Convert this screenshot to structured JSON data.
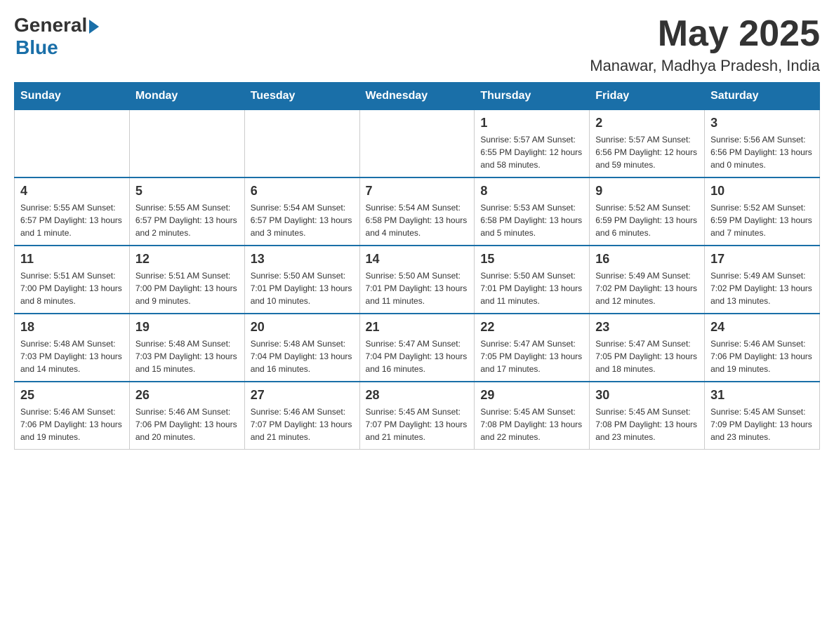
{
  "header": {
    "logo_general": "General",
    "logo_blue": "Blue",
    "month_title": "May 2025",
    "location": "Manawar, Madhya Pradesh, India"
  },
  "days_of_week": [
    "Sunday",
    "Monday",
    "Tuesday",
    "Wednesday",
    "Thursday",
    "Friday",
    "Saturday"
  ],
  "weeks": [
    [
      {
        "day": "",
        "info": ""
      },
      {
        "day": "",
        "info": ""
      },
      {
        "day": "",
        "info": ""
      },
      {
        "day": "",
        "info": ""
      },
      {
        "day": "1",
        "info": "Sunrise: 5:57 AM\nSunset: 6:55 PM\nDaylight: 12 hours\nand 58 minutes."
      },
      {
        "day": "2",
        "info": "Sunrise: 5:57 AM\nSunset: 6:56 PM\nDaylight: 12 hours\nand 59 minutes."
      },
      {
        "day": "3",
        "info": "Sunrise: 5:56 AM\nSunset: 6:56 PM\nDaylight: 13 hours\nand 0 minutes."
      }
    ],
    [
      {
        "day": "4",
        "info": "Sunrise: 5:55 AM\nSunset: 6:57 PM\nDaylight: 13 hours\nand 1 minute."
      },
      {
        "day": "5",
        "info": "Sunrise: 5:55 AM\nSunset: 6:57 PM\nDaylight: 13 hours\nand 2 minutes."
      },
      {
        "day": "6",
        "info": "Sunrise: 5:54 AM\nSunset: 6:57 PM\nDaylight: 13 hours\nand 3 minutes."
      },
      {
        "day": "7",
        "info": "Sunrise: 5:54 AM\nSunset: 6:58 PM\nDaylight: 13 hours\nand 4 minutes."
      },
      {
        "day": "8",
        "info": "Sunrise: 5:53 AM\nSunset: 6:58 PM\nDaylight: 13 hours\nand 5 minutes."
      },
      {
        "day": "9",
        "info": "Sunrise: 5:52 AM\nSunset: 6:59 PM\nDaylight: 13 hours\nand 6 minutes."
      },
      {
        "day": "10",
        "info": "Sunrise: 5:52 AM\nSunset: 6:59 PM\nDaylight: 13 hours\nand 7 minutes."
      }
    ],
    [
      {
        "day": "11",
        "info": "Sunrise: 5:51 AM\nSunset: 7:00 PM\nDaylight: 13 hours\nand 8 minutes."
      },
      {
        "day": "12",
        "info": "Sunrise: 5:51 AM\nSunset: 7:00 PM\nDaylight: 13 hours\nand 9 minutes."
      },
      {
        "day": "13",
        "info": "Sunrise: 5:50 AM\nSunset: 7:01 PM\nDaylight: 13 hours\nand 10 minutes."
      },
      {
        "day": "14",
        "info": "Sunrise: 5:50 AM\nSunset: 7:01 PM\nDaylight: 13 hours\nand 11 minutes."
      },
      {
        "day": "15",
        "info": "Sunrise: 5:50 AM\nSunset: 7:01 PM\nDaylight: 13 hours\nand 11 minutes."
      },
      {
        "day": "16",
        "info": "Sunrise: 5:49 AM\nSunset: 7:02 PM\nDaylight: 13 hours\nand 12 minutes."
      },
      {
        "day": "17",
        "info": "Sunrise: 5:49 AM\nSunset: 7:02 PM\nDaylight: 13 hours\nand 13 minutes."
      }
    ],
    [
      {
        "day": "18",
        "info": "Sunrise: 5:48 AM\nSunset: 7:03 PM\nDaylight: 13 hours\nand 14 minutes."
      },
      {
        "day": "19",
        "info": "Sunrise: 5:48 AM\nSunset: 7:03 PM\nDaylight: 13 hours\nand 15 minutes."
      },
      {
        "day": "20",
        "info": "Sunrise: 5:48 AM\nSunset: 7:04 PM\nDaylight: 13 hours\nand 16 minutes."
      },
      {
        "day": "21",
        "info": "Sunrise: 5:47 AM\nSunset: 7:04 PM\nDaylight: 13 hours\nand 16 minutes."
      },
      {
        "day": "22",
        "info": "Sunrise: 5:47 AM\nSunset: 7:05 PM\nDaylight: 13 hours\nand 17 minutes."
      },
      {
        "day": "23",
        "info": "Sunrise: 5:47 AM\nSunset: 7:05 PM\nDaylight: 13 hours\nand 18 minutes."
      },
      {
        "day": "24",
        "info": "Sunrise: 5:46 AM\nSunset: 7:06 PM\nDaylight: 13 hours\nand 19 minutes."
      }
    ],
    [
      {
        "day": "25",
        "info": "Sunrise: 5:46 AM\nSunset: 7:06 PM\nDaylight: 13 hours\nand 19 minutes."
      },
      {
        "day": "26",
        "info": "Sunrise: 5:46 AM\nSunset: 7:06 PM\nDaylight: 13 hours\nand 20 minutes."
      },
      {
        "day": "27",
        "info": "Sunrise: 5:46 AM\nSunset: 7:07 PM\nDaylight: 13 hours\nand 21 minutes."
      },
      {
        "day": "28",
        "info": "Sunrise: 5:45 AM\nSunset: 7:07 PM\nDaylight: 13 hours\nand 21 minutes."
      },
      {
        "day": "29",
        "info": "Sunrise: 5:45 AM\nSunset: 7:08 PM\nDaylight: 13 hours\nand 22 minutes."
      },
      {
        "day": "30",
        "info": "Sunrise: 5:45 AM\nSunset: 7:08 PM\nDaylight: 13 hours\nand 23 minutes."
      },
      {
        "day": "31",
        "info": "Sunrise: 5:45 AM\nSunset: 7:09 PM\nDaylight: 13 hours\nand 23 minutes."
      }
    ]
  ]
}
